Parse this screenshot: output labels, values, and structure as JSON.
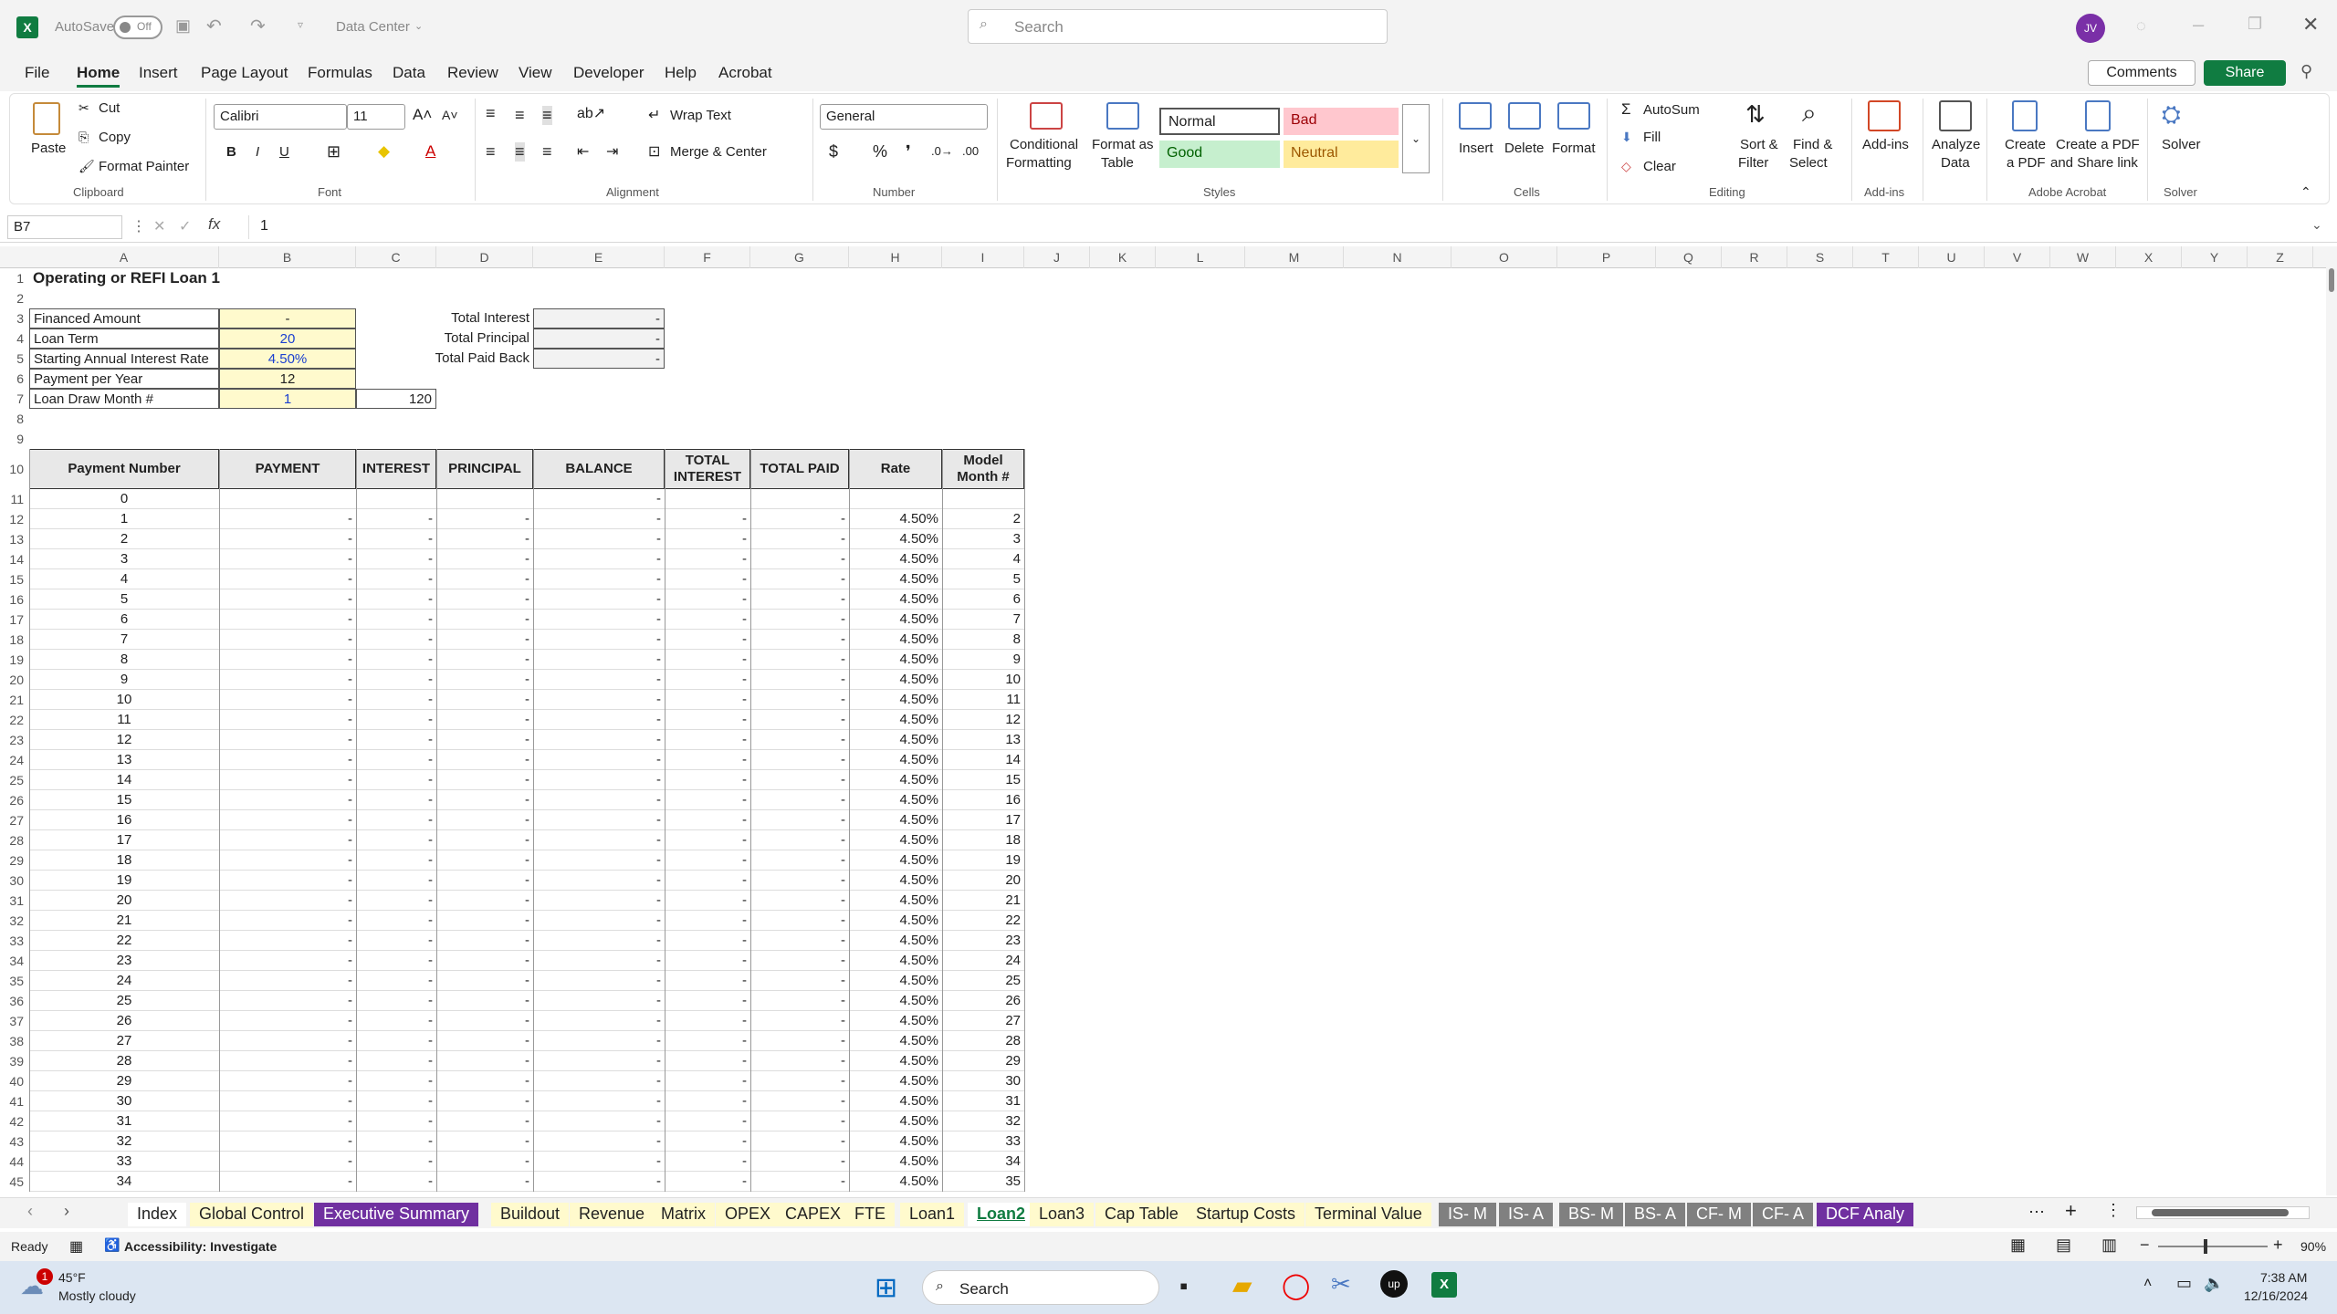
{
  "titlebar": {
    "autosave": "AutoSave",
    "autosave_state": "Off",
    "doc_name": "Data Center",
    "search_placeholder": "Search",
    "avatar": "JV"
  },
  "menu": [
    "File",
    "Home",
    "Insert",
    "Page Layout",
    "Formulas",
    "Data",
    "Review",
    "View",
    "Developer",
    "Help",
    "Acrobat"
  ],
  "menu_active": "Home",
  "comments": "Comments",
  "share": "Share",
  "ribbon": {
    "paste": "Paste",
    "cut": "Cut",
    "copy": "Copy",
    "format_painter": "Format Painter",
    "clipboard": "Clipboard",
    "font_name": "Calibri",
    "font_size": "11",
    "font": "Font",
    "wrap_text": "Wrap Text",
    "merge_center": "Merge & Center",
    "alignment": "Alignment",
    "number_format": "General",
    "number": "Number",
    "conditional": "Conditional",
    "formatting": "Formatting",
    "format_as": "Format as",
    "table": "Table",
    "style_normal": "Normal",
    "style_bad": "Bad",
    "style_good": "Good",
    "style_neutral": "Neutral",
    "styles": "Styles",
    "insert": "Insert",
    "delete": "Delete",
    "format": "Format",
    "cells": "Cells",
    "autosum": "AutoSum",
    "fill": "Fill",
    "clear": "Clear",
    "sort": "Sort &",
    "filter": "Filter",
    "find": "Find &",
    "select": "Select",
    "editing": "Editing",
    "addins": "Add-ins",
    "addins_grp": "Add-ins",
    "analyze": "Analyze",
    "data": "Data",
    "create_pdf": "Create",
    "a_pdf": "a PDF",
    "create_share": "Create a PDF",
    "and_share": "and Share link",
    "acrobat": "Adobe Acrobat",
    "solver": "Solver",
    "solver_grp": "Solver"
  },
  "formula": {
    "namebox": "B7",
    "fx": "fx",
    "value": "1"
  },
  "columns": [
    "A",
    "B",
    "C",
    "D",
    "E",
    "F",
    "G",
    "H",
    "I",
    "J",
    "K",
    "L",
    "M",
    "N",
    "O",
    "P",
    "Q",
    "R",
    "S",
    "T",
    "U",
    "V",
    "W",
    "X",
    "Y",
    "Z"
  ],
  "sheet": {
    "title": "Operating or REFI Loan 1",
    "inputs": [
      {
        "label": "Financed Amount",
        "value": "-"
      },
      {
        "label": "Loan Term",
        "value": "20"
      },
      {
        "label": "Starting Annual Interest Rate",
        "value": "4.50%"
      },
      {
        "label": "Payment per Year",
        "value": "12"
      },
      {
        "label": "Loan Draw Month #",
        "value": "1"
      }
    ],
    "c7": "120",
    "summary": [
      {
        "label": "Total Interest",
        "value": "-"
      },
      {
        "label": "Total Principal",
        "value": "-"
      },
      {
        "label": "Total Paid Back",
        "value": "-"
      }
    ],
    "headers": [
      "Payment Number",
      "PAYMENT",
      "INTEREST",
      "PRINCIPAL",
      "BALANCE",
      "TOTAL INTEREST",
      "TOTAL PAID",
      "Rate",
      "Model Month #"
    ],
    "row0": {
      "num": "0",
      "balance": "-"
    },
    "dash": "-",
    "rate": "4.50%",
    "first_payment": 1,
    "last_payment": 34,
    "month_offset": 1
  },
  "tabs": [
    "Index",
    "Global Control",
    "Executive Summary",
    "Buildout",
    "Revenue",
    "Matrix",
    "OPEX",
    "CAPEX",
    "FTE",
    "Loan1",
    "Loan2",
    "Loan3",
    "Cap Table",
    "Startup Costs",
    "Terminal Value",
    "IS- M",
    "IS- A",
    "BS- M",
    "BS- A",
    "CF- M",
    "CF- A",
    "DCF Analy"
  ],
  "active_tab": "Loan2",
  "status": {
    "ready": "Ready",
    "accessibility": "Accessibility: Investigate",
    "zoom": "90%"
  },
  "taskbar": {
    "temp": "45°F",
    "weather": "Mostly cloudy",
    "search": "Search",
    "time": "7:38 AM",
    "date": "12/16/2024",
    "badge": "1"
  }
}
